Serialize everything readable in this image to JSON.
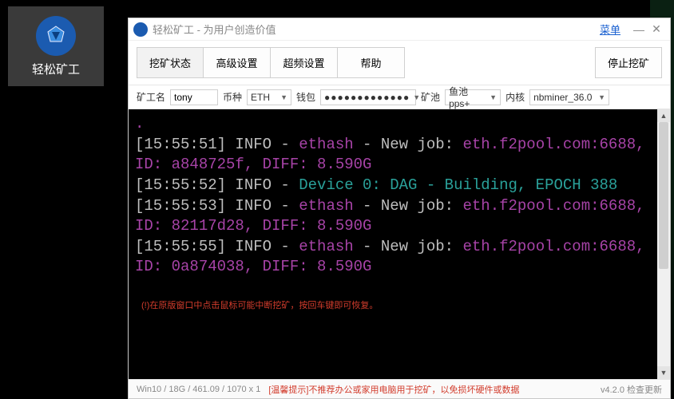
{
  "desktop": {
    "label": "轻松矿工"
  },
  "title": "轻松矿工 - 为用户创造价值",
  "menu_label": "菜单",
  "tabs": {
    "status": "挖矿状态",
    "advanced": "高级设置",
    "oc": "超频设置",
    "help": "帮助",
    "stop": "停止挖矿"
  },
  "fields": {
    "miner_label": "矿工名",
    "miner_value": "tony",
    "coin_label": "币种",
    "coin_value": "ETH",
    "wallet_label": "钱包",
    "wallet_value": "●●●●●●●●●●●●●",
    "pool_label": "矿池",
    "pool_value": "鱼池pps+",
    "core_label": "内核",
    "core_value": "nbminer_36.0"
  },
  "log": [
    {
      "ts": "[15:55:51] INFO - ",
      "a": "ethash",
      "mid": " - New job: ",
      "b": "eth.f2pool.com:6688, ID: a848725f, DIFF: 8.590G"
    },
    {
      "ts": "[15:55:52] INFO - ",
      "a": "Device 0: DAG - Building, EPOCH 388",
      "mid": "",
      "b": ""
    },
    {
      "ts": "[15:55:53] INFO - ",
      "a": "ethash",
      "mid": " - New job: ",
      "b": "eth.f2pool.com:6688, ID: 82117d28, DIFF: 8.590G"
    },
    {
      "ts": "[15:55:55] INFO - ",
      "a": "ethash",
      "mid": " - New job: ",
      "b": "eth.f2pool.com:6688, ID: 0a874038, DIFF: 8.590G"
    }
  ],
  "terminal_note": "(!)在原版窗口中点击鼠标可能中断挖矿，按回车键即可恢复。",
  "status": {
    "sys": "Win10  /  18G / 461.09  / 1070 x 1",
    "warn": "[温馨提示]不推荐办公或家用电脑用于挖矿，以免损坏硬件或数据",
    "version": "v4.2.0 检查更新"
  }
}
